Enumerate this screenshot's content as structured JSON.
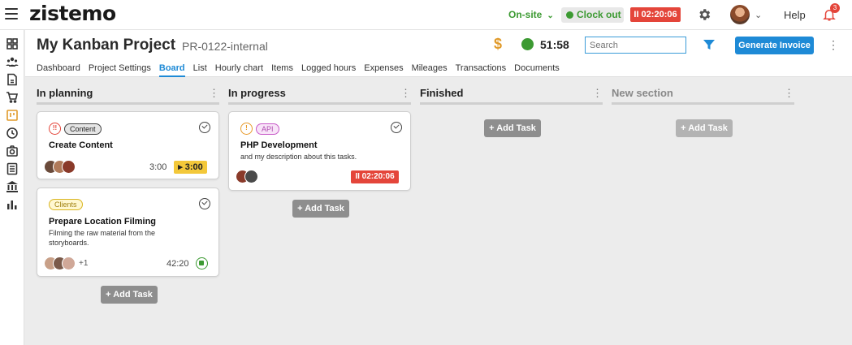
{
  "app": {
    "logo": "zistemo"
  },
  "topbar": {
    "status": "On-site",
    "clock_out": "Clock out",
    "timer": "II 02:20:06",
    "help": "Help",
    "notifications": "3"
  },
  "project": {
    "title": "My Kanban Project",
    "code": "PR-0122-internal",
    "time": "51:58",
    "search_placeholder": "Search",
    "generate_invoice": "Generate Invoice"
  },
  "tabs": [
    "Dashboard",
    "Project Settings",
    "Board",
    "List",
    "Hourly chart",
    "Items",
    "Logged hours",
    "Expenses",
    "Mileages",
    "Transactions",
    "Documents"
  ],
  "active_tab": "Board",
  "board": {
    "columns": [
      {
        "title": "In planning",
        "add_label": "Add Task"
      },
      {
        "title": "In progress",
        "add_label": "Add Task"
      },
      {
        "title": "Finished",
        "add_label": "Add Task"
      },
      {
        "title": "New section",
        "add_label": "Add Task"
      }
    ],
    "cards": {
      "create_content": {
        "priority": "!!",
        "tag": "Content",
        "title": "Create Content",
        "duration": "3:00",
        "timer": "▸ 3:00"
      },
      "prepare_filming": {
        "tag": "Clients",
        "title": "Prepare Location Filming",
        "desc": "Filming the raw material from the storyboards.",
        "extra": "+1",
        "duration": "42:20"
      },
      "php_dev": {
        "priority": "!",
        "tag": "API",
        "title": "PHP Development",
        "desc": "and my description about this tasks.",
        "timer": "II 02:20:06"
      }
    }
  },
  "colors": {
    "accent": "#1e8ad6",
    "danger": "#e4453a",
    "success": "#3c9a32",
    "warning": "#f3c83a"
  },
  "icons": [
    "menu-icon",
    "dashboard-icon",
    "team-icon",
    "document-icon",
    "cart-icon",
    "board-icon",
    "clock-icon",
    "camera-icon",
    "list-icon",
    "bank-icon",
    "chart-icon",
    "gear-icon",
    "bell-icon",
    "dollar-icon",
    "filter-icon",
    "more-icon",
    "check-icon"
  ]
}
